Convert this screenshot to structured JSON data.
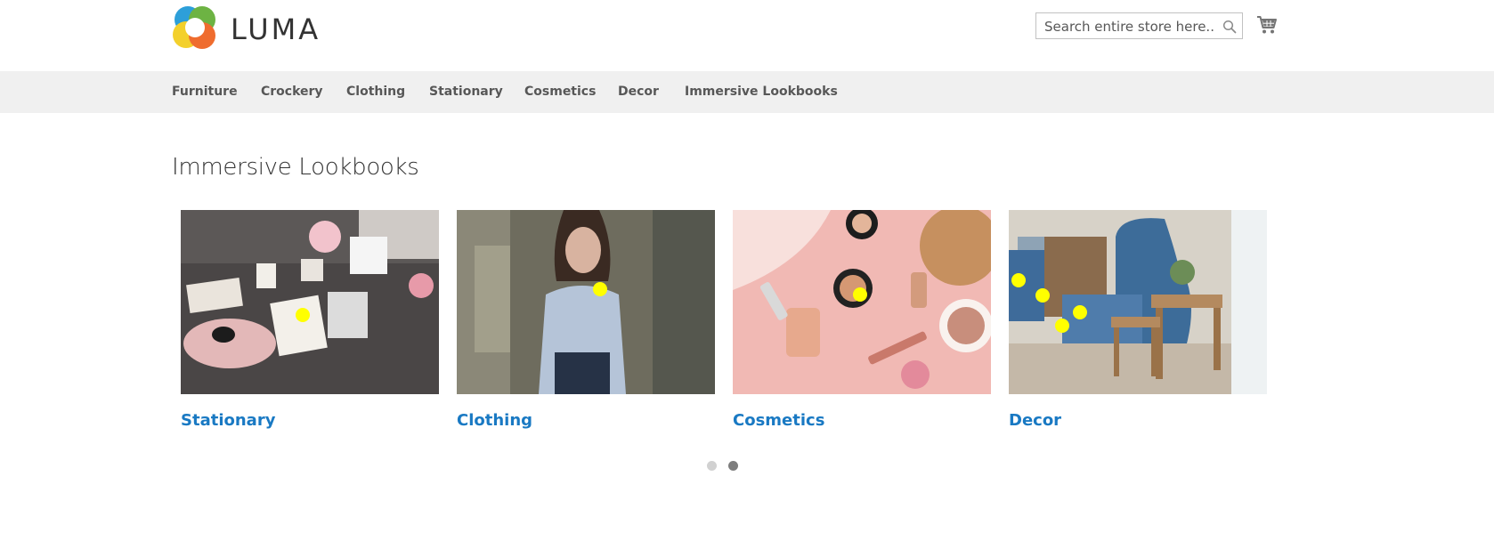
{
  "header": {
    "logo_text": "LUMA",
    "search": {
      "placeholder": "Search entire store here..."
    }
  },
  "nav": {
    "items": [
      {
        "label": "Furniture"
      },
      {
        "label": "Crockery"
      },
      {
        "label": "Clothing"
      },
      {
        "label": "Stationary"
      },
      {
        "label": "Cosmetics"
      },
      {
        "label": "Decor"
      },
      {
        "label": "Immersive Lookbooks"
      }
    ]
  },
  "main": {
    "title": "Immersive Lookbooks",
    "lookbooks": [
      {
        "label": "Stationary",
        "hotspots": 1
      },
      {
        "label": "Clothing",
        "hotspots": 1
      },
      {
        "label": "Cosmetics",
        "hotspots": 1
      },
      {
        "label": "Decor",
        "hotspots": 4
      }
    ],
    "pager": {
      "pages": 2,
      "active": 2
    }
  },
  "colors": {
    "link": "#1979c3",
    "nav_bg": "#f0f0f0",
    "hotspot": "#ffff00",
    "dot_inactive": "#d1d1d1",
    "dot_active": "#7d7d7d"
  }
}
